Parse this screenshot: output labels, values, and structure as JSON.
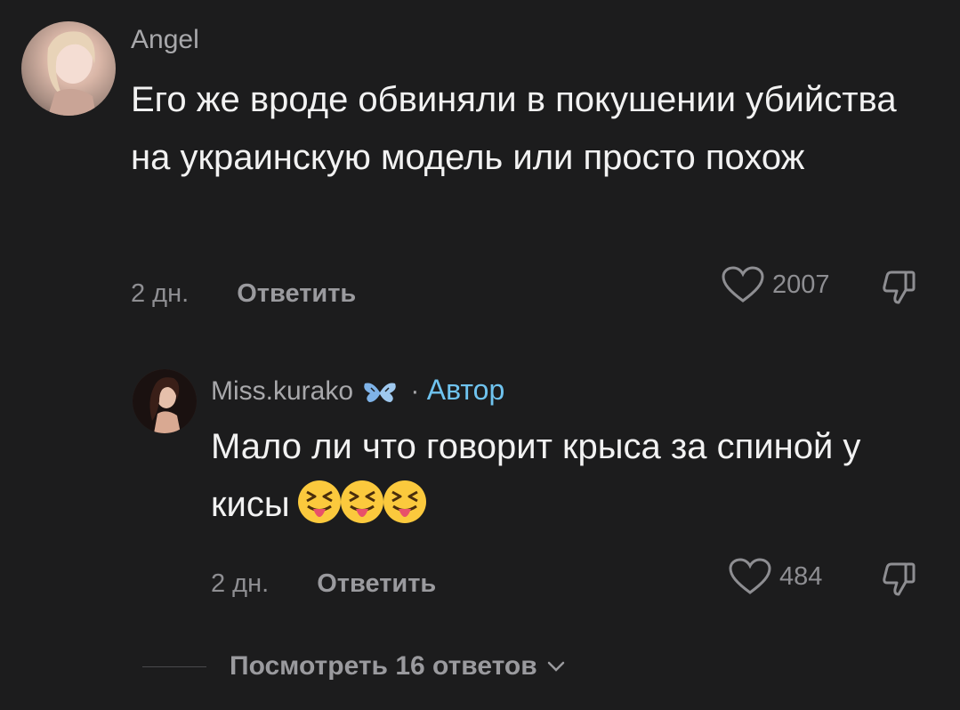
{
  "comments": {
    "main": {
      "username": "Angel",
      "text": "Его же вроде обвиняли в покушении убийства на украинскую модель или просто похож",
      "time": "2 дн.",
      "reply_label": "Ответить",
      "likes": "2007"
    },
    "reply": {
      "username": "Miss.kurako",
      "separator": "·",
      "author_label": "Автор",
      "text": "Мало ли что говорит крыса за спиной у кисы",
      "emojis": [
        "squinting-tongue-emoji",
        "squinting-tongue-emoji",
        "squinting-tongue-emoji"
      ],
      "time": "2 дн.",
      "reply_label": "Ответить",
      "likes": "484"
    }
  },
  "view_replies": {
    "label": "Посмотреть 16 ответов"
  },
  "colors": {
    "background": "#1c1c1d",
    "text": "#f2f2f2",
    "muted": "#8e8e92",
    "author_accent": "#6fc3ef"
  },
  "icons": [
    "heart-icon",
    "thumbs-down-icon",
    "butterfly-icon",
    "chevron-down-icon"
  ]
}
